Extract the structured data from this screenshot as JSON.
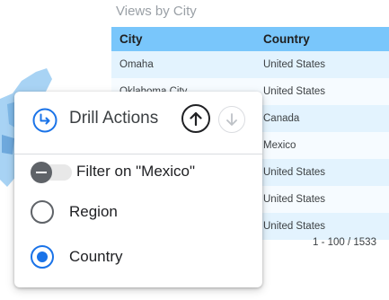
{
  "chart": {
    "title": "Views by City",
    "columns": [
      "City",
      "Country"
    ],
    "rows": [
      {
        "city": "Omaha",
        "country": "United States"
      },
      {
        "city": "Oklahoma City",
        "country": "United States"
      },
      {
        "city": "",
        "country": "Canada"
      },
      {
        "city": "",
        "country": "Mexico"
      },
      {
        "city": "",
        "country": "United States"
      },
      {
        "city": "",
        "country": "United States"
      },
      {
        "city": "",
        "country": "United States"
      }
    ],
    "pagination": "1 - 100 / 1533"
  },
  "popup": {
    "title": "Drill Actions",
    "filter_label": "Filter on \"Mexico\"",
    "filter_enabled": false,
    "options": [
      {
        "label": "Region",
        "selected": false
      },
      {
        "label": "Country",
        "selected": true
      }
    ]
  },
  "colors": {
    "header": "#79c6fb",
    "accent": "#1a73e8",
    "row_odd": "#e3f3fe",
    "row_even": "#f6fbff"
  },
  "icons": {
    "drill": "drill-actions-icon",
    "up": "arrow-up-icon",
    "down": "arrow-down-icon"
  }
}
